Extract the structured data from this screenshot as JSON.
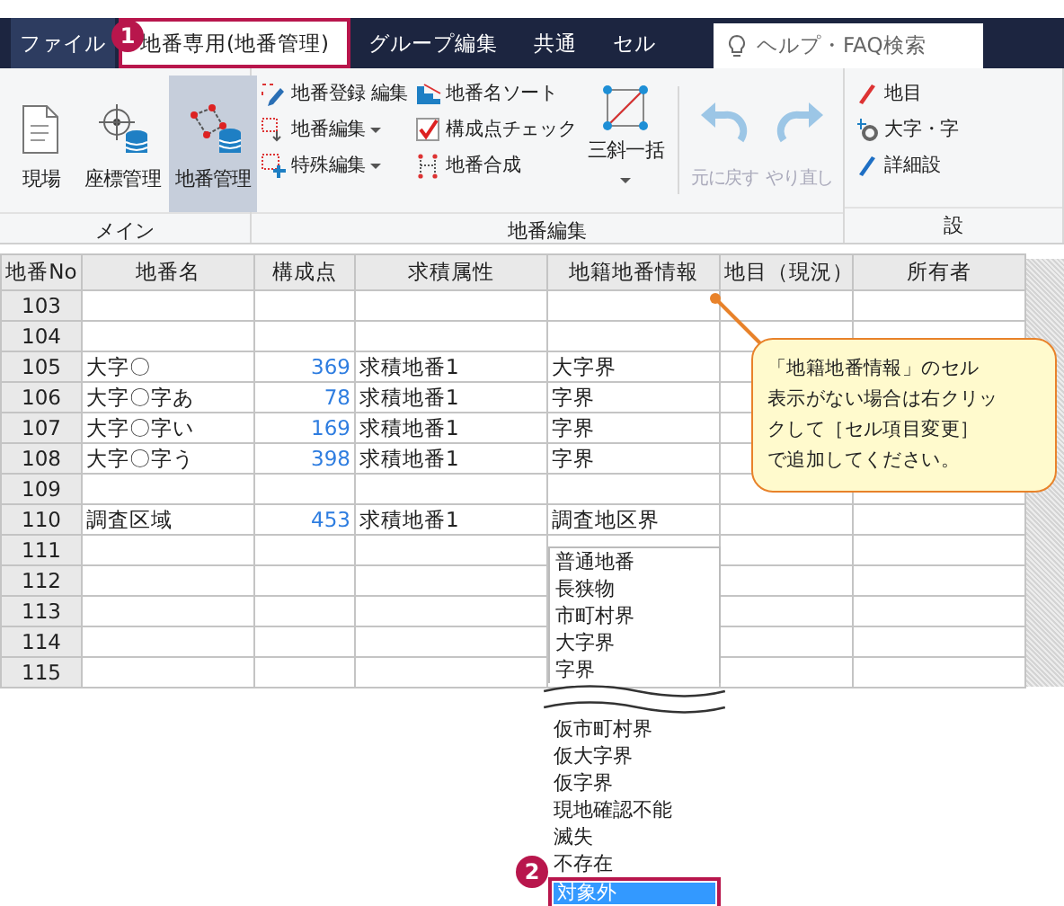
{
  "tabs": [
    {
      "label": "ファイル",
      "kind": "file",
      "selected": false
    },
    {
      "label": "地番専用(地番管理)",
      "kind": "tab",
      "selected": true
    },
    {
      "label": "グループ編集",
      "kind": "tab",
      "selected": false
    },
    {
      "label": "共通",
      "kind": "tab",
      "selected": false
    },
    {
      "label": "セル",
      "kind": "tab",
      "selected": false
    }
  ],
  "search": {
    "placeholder": "ヘルプ・FAQ検索"
  },
  "ribbon": {
    "groups": [
      {
        "label": "メイン",
        "columns": [
          {
            "kind": "large",
            "buttons": [
              {
                "label": "現場",
                "selected": false,
                "disabled": false
              }
            ]
          },
          {
            "kind": "large",
            "buttons": [
              {
                "label": "座標管理",
                "selected": false,
                "disabled": false
              }
            ]
          },
          {
            "kind": "large",
            "buttons": [
              {
                "label": "地番管理",
                "selected": true,
                "disabled": false
              }
            ]
          }
        ]
      },
      {
        "label": "地番編集",
        "columns": [
          {
            "kind": "small",
            "buttons": [
              {
                "label": "地番登録 編集",
                "has_menu": false
              },
              {
                "label": "地番編集",
                "has_menu": true
              },
              {
                "label": "特殊編集",
                "has_menu": true
              }
            ]
          },
          {
            "kind": "small",
            "buttons": [
              {
                "label": "地番名ソート",
                "has_menu": false
              },
              {
                "label": "構成点チェック",
                "has_menu": false
              },
              {
                "label": "地番合成",
                "has_menu": false
              }
            ]
          },
          {
            "kind": "large",
            "buttons": [
              {
                "label": "三斜一括",
                "selected": false,
                "disabled": false,
                "has_menu": true
              }
            ]
          },
          {
            "kind": "separator"
          },
          {
            "kind": "large",
            "buttons": [
              {
                "label": "元に戻す",
                "selected": false,
                "disabled": true
              }
            ]
          },
          {
            "kind": "large",
            "buttons": [
              {
                "label": "やり直し",
                "selected": false,
                "disabled": true
              }
            ]
          }
        ]
      },
      {
        "label": "設",
        "columns": [
          {
            "kind": "small",
            "buttons": [
              {
                "label": "地目",
                "has_menu": false
              },
              {
                "label": "大字・字",
                "has_menu": false
              },
              {
                "label": "詳細設",
                "has_menu": false
              }
            ]
          }
        ]
      }
    ]
  },
  "table": {
    "columns": [
      {
        "label": "地番No",
        "kind": "rowhead"
      },
      {
        "label": "地番名",
        "kind": "text"
      },
      {
        "label": "構成点",
        "kind": "number"
      },
      {
        "label": "求積属性",
        "kind": "text"
      },
      {
        "label": "地籍地番情報",
        "kind": "text"
      },
      {
        "label": "地目（現況）",
        "kind": "text"
      },
      {
        "label": "所有者",
        "kind": "text"
      }
    ],
    "rows": [
      [
        "103",
        "",
        "",
        "",
        "",
        "",
        ""
      ],
      [
        "104",
        "",
        "",
        "",
        "",
        "",
        ""
      ],
      [
        "105",
        "大字〇",
        "369",
        "求積地番1",
        "大字界",
        "",
        ""
      ],
      [
        "106",
        "大字〇字あ",
        "78",
        "求積地番1",
        "字界",
        "",
        ""
      ],
      [
        "107",
        "大字〇字い",
        "169",
        "求積地番1",
        "字界",
        "",
        ""
      ],
      [
        "108",
        "大字〇字う",
        "398",
        "求積地番1",
        "字界",
        "",
        ""
      ],
      [
        "109",
        "",
        "",
        "",
        "",
        "",
        ""
      ],
      [
        "110",
        "調査区域",
        "453",
        "求積地番1",
        "調査地区界",
        "",
        ""
      ],
      [
        "111",
        "",
        "",
        "",
        "",
        "",
        ""
      ],
      [
        "112",
        "",
        "",
        "",
        "",
        "",
        ""
      ],
      [
        "113",
        "",
        "",
        "",
        "",
        "",
        ""
      ],
      [
        "114",
        "",
        "",
        "",
        "",
        "",
        ""
      ],
      [
        "115",
        "",
        "",
        "",
        "",
        "",
        ""
      ]
    ]
  },
  "dropdown": {
    "items": [
      {
        "kind": "item",
        "label": "普通地番",
        "selected": false
      },
      {
        "kind": "item",
        "label": "長狭物",
        "selected": false
      },
      {
        "kind": "item",
        "label": "市町村界",
        "selected": false
      },
      {
        "kind": "item",
        "label": "大字界",
        "selected": false
      },
      {
        "kind": "item",
        "label": "字界",
        "selected": false
      },
      {
        "kind": "break"
      },
      {
        "kind": "item",
        "label": "仮市町村界",
        "selected": false
      },
      {
        "kind": "item",
        "label": "仮大字界",
        "selected": false
      },
      {
        "kind": "item",
        "label": "仮字界",
        "selected": false
      },
      {
        "kind": "item",
        "label": "現地確認不能",
        "selected": false
      },
      {
        "kind": "item",
        "label": "滅失",
        "selected": false
      },
      {
        "kind": "item",
        "label": "不存在",
        "selected": false
      },
      {
        "kind": "item",
        "label": "対象外",
        "selected": true
      }
    ]
  },
  "callout": {
    "lines": [
      "「地籍地番情報」のセル",
      "表示がない場合は右クリッ",
      "クして［セル項目変更］",
      "で追加してください。"
    ]
  },
  "markers": [
    {
      "label": "1"
    },
    {
      "label": "2"
    }
  ]
}
